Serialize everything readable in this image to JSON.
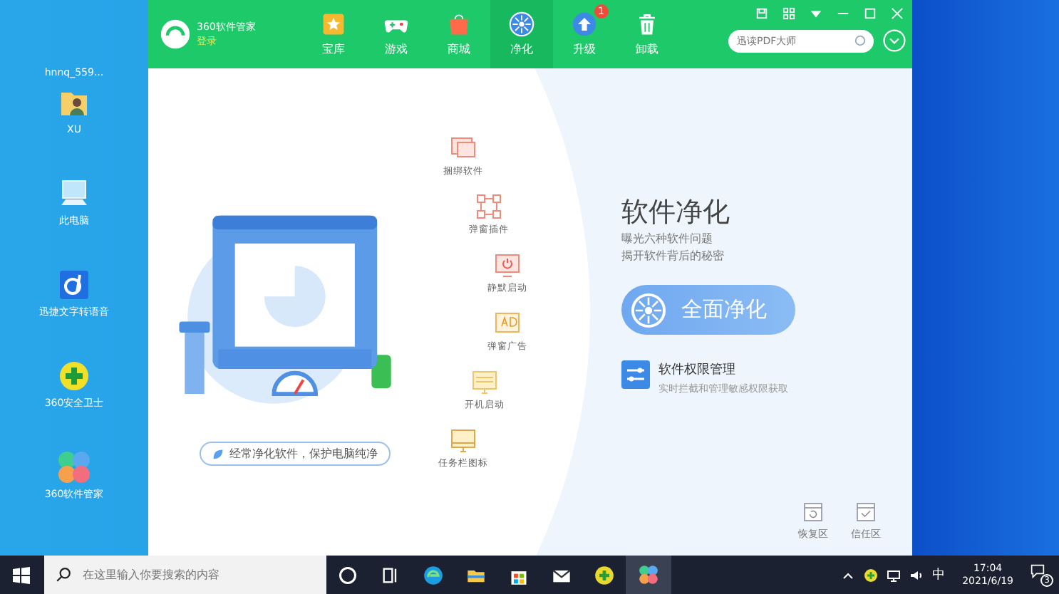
{
  "desktop_icons": [
    {
      "label": "hnnq_559...",
      "kind": "file"
    },
    {
      "label": "XU",
      "kind": "user-folder"
    },
    {
      "label": "此电脑",
      "kind": "computer"
    },
    {
      "label": "迅捷文字转语音",
      "kind": "app-t"
    },
    {
      "label": "360安全卫士",
      "kind": "safe"
    },
    {
      "label": "360软件管家",
      "kind": "manager"
    }
  ],
  "app": {
    "title": "360软件管家",
    "login": "登录",
    "tabs": [
      {
        "label": "宝库",
        "kind": "treasure",
        "selected": false
      },
      {
        "label": "游戏",
        "kind": "games",
        "selected": false
      },
      {
        "label": "商城",
        "kind": "store",
        "selected": false
      },
      {
        "label": "净化",
        "kind": "purify",
        "selected": true
      },
      {
        "label": "升级",
        "kind": "upgrade",
        "selected": false,
        "badge": "1"
      },
      {
        "label": "卸载",
        "kind": "uninstall",
        "selected": false
      }
    ],
    "search": {
      "placeholder": "迅读PDF大师"
    }
  },
  "cleanup_items": [
    {
      "label": "捆绑软件",
      "kind": "bundle"
    },
    {
      "label": "弹窗插件",
      "kind": "plugin"
    },
    {
      "label": "静默启动",
      "kind": "silent"
    },
    {
      "label": "弹窗广告",
      "kind": "ad"
    },
    {
      "label": "开机启动",
      "kind": "startup"
    },
    {
      "label": "任务栏图标",
      "kind": "tray"
    }
  ],
  "banner": "经常净化软件，保护电脑纯净",
  "heading": "软件净化",
  "description": [
    "曝光六种软件问题",
    "揭开软件背后的秘密"
  ],
  "primary_button": "全面净化",
  "feature": {
    "title": "软件权限管理",
    "subtitle": "实时拦截和管理敏感权限获取"
  },
  "bottom_links": [
    "恢复区",
    "信任区"
  ],
  "taskbar": {
    "search": {
      "placeholder": "在这里输入你要搜索的内容"
    },
    "ime": "中",
    "time": "17:04",
    "date": "2021/6/19",
    "notifications": "3"
  }
}
